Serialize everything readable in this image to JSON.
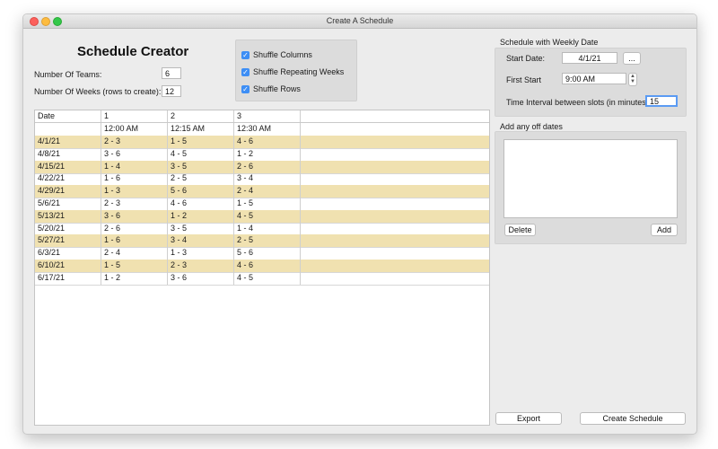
{
  "window": {
    "title": "Create A Schedule"
  },
  "header": {
    "heading": "Schedule Creator"
  },
  "form": {
    "teams_label": "Number Of Teams:",
    "teams_value": "6",
    "weeks_label": "Number Of Weeks (rows to create):",
    "weeks_value": "12"
  },
  "options": {
    "shuffle_columns": "Shuffle Columns",
    "shuffle_repeating_weeks": "Shuffle Repeating Weeks",
    "shuffle_rows": "Shuffle Rows",
    "shuffle_columns_checked": true,
    "shuffle_repeating_weeks_checked": true,
    "shuffle_rows_checked": true
  },
  "table": {
    "headers": [
      "Date",
      "1",
      "2",
      "3"
    ],
    "times": [
      "",
      "12:00 AM",
      "12:15 AM",
      "12:30 AM"
    ],
    "rows": [
      [
        "4/1/21",
        "2 - 3",
        "1 - 5",
        "4 - 6"
      ],
      [
        "4/8/21",
        "3 - 6",
        "4 - 5",
        "1 - 2"
      ],
      [
        "4/15/21",
        "1 - 4",
        "3 - 5",
        "2 - 6"
      ],
      [
        "4/22/21",
        "1 - 6",
        "2 - 5",
        "3 - 4"
      ],
      [
        "4/29/21",
        "1 - 3",
        "5 - 6",
        "2 - 4"
      ],
      [
        "5/6/21",
        "2 - 3",
        "4 - 6",
        "1 - 5"
      ],
      [
        "5/13/21",
        "3 - 6",
        "1 - 2",
        "4 - 5"
      ],
      [
        "5/20/21",
        "2 - 6",
        "3 - 5",
        "1 - 4"
      ],
      [
        "5/27/21",
        "1 - 6",
        "3 - 4",
        "2 - 5"
      ],
      [
        "6/3/21",
        "2 - 4",
        "1 - 3",
        "5 - 6"
      ],
      [
        "6/10/21",
        "1 - 5",
        "2 - 3",
        "4 - 6"
      ],
      [
        "6/17/21",
        "1 - 2",
        "3 - 6",
        "4 - 5"
      ]
    ]
  },
  "weekly": {
    "section_title": "Schedule with Weekly Date",
    "start_date_label": "Start Date:",
    "start_date_value": "4/1/21",
    "picker_label": "...",
    "first_start_label": "First Start",
    "first_start_value": "9:00 AM",
    "interval_label": "Time Interval between slots (in minutes):",
    "interval_value": "15"
  },
  "off_dates": {
    "section_title": "Add any off dates",
    "delete_label": "Delete",
    "add_label": "Add"
  },
  "footer": {
    "export_label": "Export",
    "create_label": "Create Schedule"
  },
  "colors": {
    "alt_row": "#f0e1b0",
    "checkbox": "#3d8ef5",
    "focus": "#5b9bf3"
  }
}
